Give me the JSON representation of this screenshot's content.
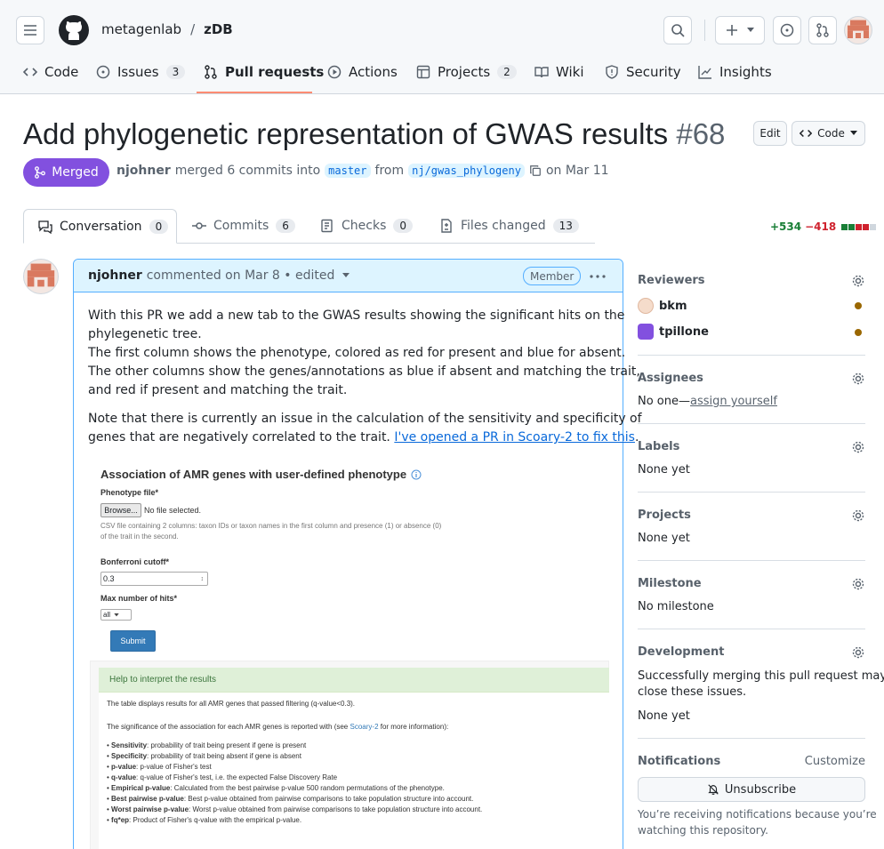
{
  "header": {
    "owner": "metagenlab",
    "separator": "/",
    "repo": "zDB"
  },
  "repo_tabs": [
    {
      "label": "Code",
      "count": null
    },
    {
      "label": "Issues",
      "count": "3"
    },
    {
      "label": "Pull requests",
      "count": null
    },
    {
      "label": "Actions",
      "count": null
    },
    {
      "label": "Projects",
      "count": "2"
    },
    {
      "label": "Wiki",
      "count": null
    },
    {
      "label": "Security",
      "count": null
    },
    {
      "label": "Insights",
      "count": null
    }
  ],
  "pr": {
    "title": "Add phylogenetic representation of GWAS results",
    "number": "#68",
    "edit_label": "Edit",
    "code_label": "Code",
    "state": "Merged",
    "author": "njohner",
    "merge_text": "merged 6 commits into",
    "base_branch": "master",
    "from_text": "from",
    "head_branch": "nj/gwas_phylogeny",
    "date_text": "on Mar 11"
  },
  "pr_tabs": [
    {
      "label": "Conversation",
      "count": "0"
    },
    {
      "label": "Commits",
      "count": "6"
    },
    {
      "label": "Checks",
      "count": "0"
    },
    {
      "label": "Files changed",
      "count": "13"
    }
  ],
  "diffstat": {
    "added": "+534",
    "removed": "−418"
  },
  "comment": {
    "author": "njohner",
    "meta": "commented on Mar 8 • edited",
    "role": "Member",
    "para1_line1": "With this PR we add a new tab to the GWAS results showing the significant hits on the",
    "para1_line2": "phylegenetic tree.",
    "para1_line3": "The first column shows the phenotype, colored as red for present and blue for absent.",
    "para1_line4": "The other columns show the genes/annotations as blue if absent and matching the trait,",
    "para1_line5": "and red if present and matching the trait.",
    "para2_line1": "Note that there is currently an issue in the calculation of the sensitivity and specificity of",
    "para2_line2_prefix": "genes that are negatively correlated to the trait.",
    "para2_link": "I've opened a PR in Scoary-2 to fix this",
    "para2_suffix": "."
  },
  "screenshot": {
    "heading": "Association of AMR genes with user-defined phenotype",
    "phenotype_label": "Phenotype file*",
    "browse_label": "Browse...",
    "no_file": "No file selected.",
    "csv_help_1": "CSV file containing 2 columns: taxon IDs or taxon names in the first column and presence (1) or absence (0)",
    "csv_help_2": "of the trait in the second.",
    "bonferroni_label": "Bonferroni cutoff*",
    "bonferroni_value": "0.3",
    "max_hits_label": "Max number of hits*",
    "max_hits_value": "all",
    "submit_label": "Submit",
    "help_title": "Help to interpret the results",
    "help_p1": "The table displays results for all AMR genes that passed filtering (q-value<0.3).",
    "help_p2_prefix": "The significance of the association for each AMR genes is reported with (see",
    "help_p2_link": "Scoary-2",
    "help_p2_suffix": "for more information):",
    "bullets": [
      {
        "term": "Sensitivity",
        "desc": ": probability of trait being present if gene is present"
      },
      {
        "term": "Specificity",
        "desc": ": probability of trait being absent if gene is absent"
      },
      {
        "term": "p-value",
        "desc": ": p-value of Fisher's test"
      },
      {
        "term": "q-value",
        "desc": ": q-value of Fisher's test, i.e. the expected False Discovery Rate"
      },
      {
        "term": "Empirical p-value",
        "desc": ": Calculated from the best pairwise p-value 500 random permutations of the phenotype."
      },
      {
        "term": "Best pairwise p-value",
        "desc": ": Best p-value obtained from pairwise comparisons to take population structure into account."
      },
      {
        "term": "Worst pairwise p-value",
        "desc": ": Worst p-value obtained from pairwise comparisons to take population structure into account."
      },
      {
        "term": "fq*ep",
        "desc": ": Product of Fisher's q-value with the empirical p-value."
      }
    ]
  },
  "sidebar": {
    "reviewers_title": "Reviewers",
    "reviewers": [
      {
        "name": "bkm"
      },
      {
        "name": "tpillone"
      }
    ],
    "assignees_title": "Assignees",
    "assignees_none": "No one—",
    "assign_yourself": "assign yourself",
    "labels_title": "Labels",
    "labels_value": "None yet",
    "projects_title": "Projects",
    "projects_value": "None yet",
    "milestone_title": "Milestone",
    "milestone_value": "No milestone",
    "development_title": "Development",
    "development_line1": "Successfully merging this pull request may",
    "development_line2": "close these issues.",
    "development_value": "None yet",
    "notifications_title": "Notifications",
    "customize_label": "Customize",
    "unsubscribe_label": "Unsubscribe",
    "notif_line1": "You’re receiving notifications because you’re",
    "notif_line2": "watching this repository."
  },
  "colors": {
    "merged": "#8250df",
    "accent_tab": "#fd8c73",
    "added": "#1a7f37",
    "removed": "#cf222e",
    "link": "#0969da",
    "comment_header_bg": "#ddf4ff",
    "pending_dot": "#9a6700"
  },
  "icons": [
    "hamburger-icon",
    "github-logo-icon",
    "search-icon",
    "plus-icon",
    "issue-icon",
    "pull-request-icon",
    "avatar-icon",
    "code-icon",
    "play-icon",
    "table-icon",
    "book-icon",
    "shield-icon",
    "graph-icon",
    "merge-icon",
    "copy-icon",
    "conversation-icon",
    "commit-icon",
    "checklist-icon",
    "file-diff-icon",
    "kebab-icon",
    "gear-icon",
    "bell-slash-icon",
    "info-icon"
  ]
}
